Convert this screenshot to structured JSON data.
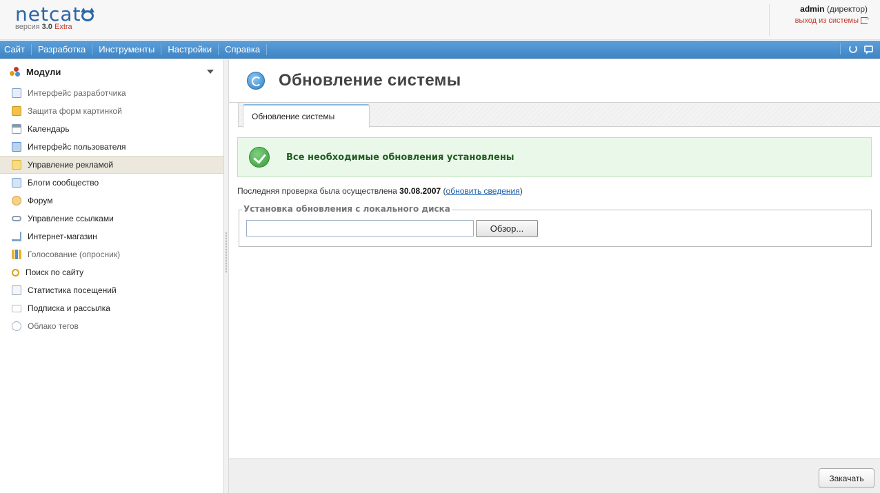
{
  "header": {
    "logo_text": "netcat",
    "version_prefix": "версия",
    "version_number": "3.0",
    "version_edition": "Extra",
    "user_name": "admin",
    "user_role": "(директор)",
    "logout_label": "выход из системы"
  },
  "menu": {
    "items": [
      "Сайт",
      "Разработка",
      "Инструменты",
      "Настройки",
      "Справка"
    ],
    "icons": [
      "refresh-icon",
      "chat-icon"
    ]
  },
  "sidebar": {
    "title": "Модули",
    "items": [
      {
        "label": "Интерфейс разработчика",
        "icon": "wrench-icon",
        "color": "#7a9cc6"
      },
      {
        "label": "Защита форм картинкой",
        "icon": "lock-image-icon",
        "color": "#e0a21a"
      },
      {
        "label": "Календарь",
        "icon": "calendar-icon",
        "color": "#8899aa"
      },
      {
        "label": "Интерфейс пользователя",
        "icon": "user-icon",
        "color": "#5a8fd0"
      },
      {
        "label": "Управление рекламой",
        "icon": "ad-icon",
        "color": "#e8c25a"
      },
      {
        "label": "Блоги сообщество",
        "icon": "blog-icon",
        "color": "#6c9bd8"
      },
      {
        "label": "Форум",
        "icon": "forum-icon",
        "color": "#d9a040"
      },
      {
        "label": "Управление ссылками",
        "icon": "link-icon",
        "color": "#8a9bb0"
      },
      {
        "label": "Интернет-магазин",
        "icon": "cart-icon",
        "color": "#7fa3c8"
      },
      {
        "label": "Голосование (опросник)",
        "icon": "poll-icon",
        "color": "#e8b030"
      },
      {
        "label": "Поиск по сайту",
        "icon": "search-icon",
        "color": "#d9a020"
      },
      {
        "label": "Статистика посещений",
        "icon": "stats-icon",
        "color": "#9aa8b8"
      },
      {
        "label": "Подписка и рассылка",
        "icon": "mail-icon",
        "color": "#b0b8c4"
      },
      {
        "label": "Облако тегов",
        "icon": "tag-cloud-icon",
        "color": "#a8b4c0"
      }
    ]
  },
  "main": {
    "title": "Обновление системы",
    "tab_label": "Обновление системы",
    "success_message": "Все необходимые обновления установлены",
    "lastcheck_prefix": "Последняя проверка была осуществлена",
    "lastcheck_date": "30.08.2007",
    "lastcheck_link": "обновить сведения",
    "fieldset_legend": "Установка обновления с локального диска",
    "file_input_value": "",
    "browse_label": "Обзор...",
    "download_label": "Закачать"
  }
}
